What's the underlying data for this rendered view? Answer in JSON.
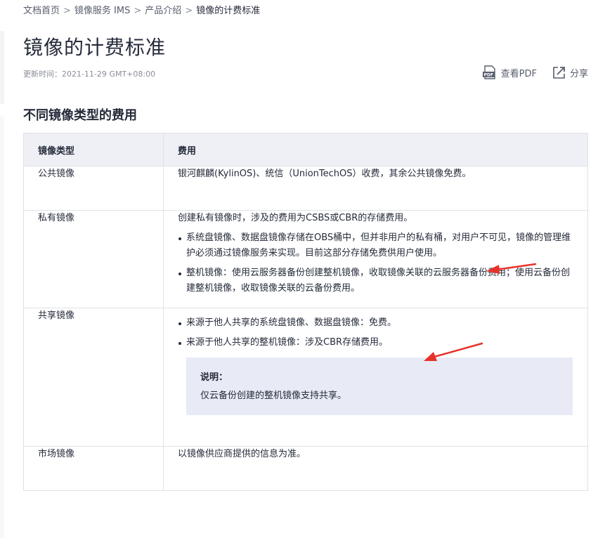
{
  "breadcrumb": {
    "items": [
      "文档首页",
      "镜像服务 IMS",
      "产品介绍",
      "镜像的计费标准"
    ],
    "separator": ">"
  },
  "page": {
    "title": "镜像的计费标准",
    "update_time": "更新时间：2021-11-29 GMT+08:00"
  },
  "actions": {
    "pdf_label": "查看PDF",
    "share_label": "分享"
  },
  "section": {
    "title": "不同镜像类型的费用"
  },
  "table": {
    "headers": [
      "镜像类型",
      "费用"
    ],
    "rows": {
      "public": {
        "type": "公共镜像",
        "fee": "银河麒麟(KylinOS)、统信（UnionTechOS）收费，其余公共镜像免费。"
      },
      "private": {
        "type": "私有镜像",
        "intro": "创建私有镜像时，涉及的费用为CSBS或CBR的存储费用。",
        "bullets": [
          "系统盘镜像、数据盘镜像存储在OBS桶中，但并非用户的私有桶，对用户不可见，镜像的管理维护必须通过镜像服务来实现。目前这部分存储免费供用户使用。",
          "整机镜像：使用云服务器备份创建整机镜像，收取镜像关联的云服务器备份费用；使用云备份创建整机镜像，收取镜像关联的云备份费用。"
        ]
      },
      "shared": {
        "type": "共享镜像",
        "bullets": [
          "来源于他人共享的系统盘镜像、数据盘镜像：免费。",
          "来源于他人共享的整机镜像：涉及CBR存储费用。"
        ],
        "note_title": "说明：",
        "note_text": "仅云备份创建的整机镜像支持共享。"
      },
      "market": {
        "type": "市场镜像",
        "fee": "以镜像供应商提供的信息为准。"
      }
    }
  },
  "colors": {
    "text": "#252b3a",
    "muted": "#8a8e99",
    "header_bg": "#eef0f5",
    "note_bg": "#e8ebf6",
    "border": "#dfe1e6",
    "annotation_arrow": "#e8312a"
  }
}
